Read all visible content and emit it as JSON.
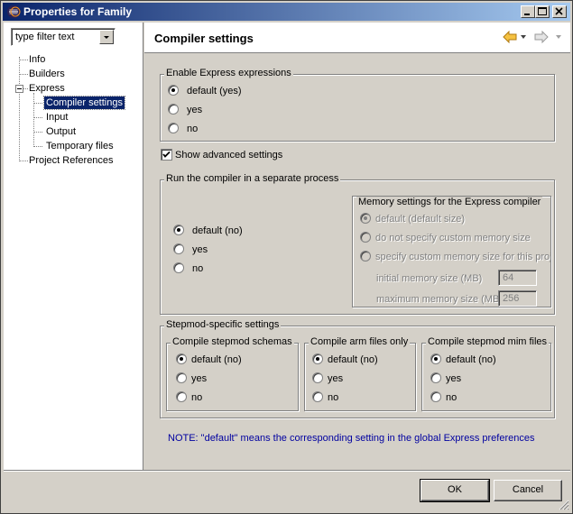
{
  "window": {
    "title": "Properties for Family",
    "controls": {
      "minimize": "minimize-icon",
      "maximize": "maximize-icon",
      "close": "close-icon"
    }
  },
  "sidebar": {
    "filter_value": "type filter text",
    "tree": [
      {
        "label": "Info"
      },
      {
        "label": "Builders"
      },
      {
        "label": "Express",
        "expanded": true
      },
      {
        "label": "Compiler settings",
        "selected": true
      },
      {
        "label": "Input"
      },
      {
        "label": "Output"
      },
      {
        "label": "Temporary files"
      },
      {
        "label": "Project References"
      }
    ]
  },
  "header": {
    "title": "Compiler settings",
    "nav": [
      "back-arrow-icon",
      "dropdown-icon",
      "forward-arrow-icon",
      "dropdown-icon"
    ]
  },
  "express_expressions": {
    "label": "Enable Express expressions",
    "options": [
      "default (yes)",
      "yes",
      "no"
    ],
    "selected": 0
  },
  "advanced": {
    "label": "Show advanced settings",
    "checked": true
  },
  "separate_process": {
    "label": "Run the compiler in a separate process",
    "options": [
      "default (no)",
      "yes",
      "no"
    ],
    "selected": 0,
    "memory": {
      "label": "Memory settings for the Express compiler",
      "options": [
        "default (default size)",
        "do not specify custom memory size",
        "specify custom memory size for this proje"
      ],
      "selected": 0,
      "enabled": false,
      "initial_label": "initial memory size (MB)",
      "initial_value": "64",
      "maximum_label": "maximum memory size (MB)",
      "maximum_value": "256"
    }
  },
  "stepmod": {
    "label": "Stepmod-specific settings",
    "groups": [
      {
        "label": "Compile stepmod schemas",
        "options": [
          "default (no)",
          "yes",
          "no"
        ],
        "selected": 0
      },
      {
        "label": "Compile arm files only",
        "options": [
          "default (no)",
          "yes",
          "no"
        ],
        "selected": 0
      },
      {
        "label": "Compile stepmod mim files",
        "options": [
          "default (no)",
          "yes",
          "no"
        ],
        "selected": 0
      }
    ]
  },
  "note": "NOTE: \"default\" means the corresponding setting in the global Express preferences",
  "buttons": {
    "ok": "OK",
    "cancel": "Cancel"
  },
  "colors": {
    "title_start": "#0a246a",
    "title_end": "#a6caf0",
    "note": "#0000a0",
    "face": "#d4d0c8"
  }
}
